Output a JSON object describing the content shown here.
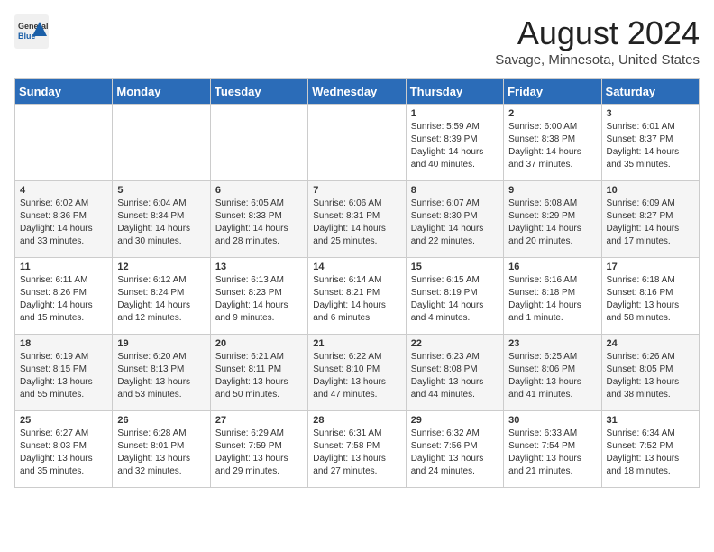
{
  "header": {
    "logo_general": "General",
    "logo_blue": "Blue",
    "month": "August 2024",
    "location": "Savage, Minnesota, United States"
  },
  "weekdays": [
    "Sunday",
    "Monday",
    "Tuesday",
    "Wednesday",
    "Thursday",
    "Friday",
    "Saturday"
  ],
  "weeks": [
    [
      {
        "day": "",
        "info": ""
      },
      {
        "day": "",
        "info": ""
      },
      {
        "day": "",
        "info": ""
      },
      {
        "day": "",
        "info": ""
      },
      {
        "day": "1",
        "sunrise": "Sunrise: 5:59 AM",
        "sunset": "Sunset: 8:39 PM",
        "daylight": "Daylight: 14 hours and 40 minutes."
      },
      {
        "day": "2",
        "sunrise": "Sunrise: 6:00 AM",
        "sunset": "Sunset: 8:38 PM",
        "daylight": "Daylight: 14 hours and 37 minutes."
      },
      {
        "day": "3",
        "sunrise": "Sunrise: 6:01 AM",
        "sunset": "Sunset: 8:37 PM",
        "daylight": "Daylight: 14 hours and 35 minutes."
      }
    ],
    [
      {
        "day": "4",
        "sunrise": "Sunrise: 6:02 AM",
        "sunset": "Sunset: 8:36 PM",
        "daylight": "Daylight: 14 hours and 33 minutes."
      },
      {
        "day": "5",
        "sunrise": "Sunrise: 6:04 AM",
        "sunset": "Sunset: 8:34 PM",
        "daylight": "Daylight: 14 hours and 30 minutes."
      },
      {
        "day": "6",
        "sunrise": "Sunrise: 6:05 AM",
        "sunset": "Sunset: 8:33 PM",
        "daylight": "Daylight: 14 hours and 28 minutes."
      },
      {
        "day": "7",
        "sunrise": "Sunrise: 6:06 AM",
        "sunset": "Sunset: 8:31 PM",
        "daylight": "Daylight: 14 hours and 25 minutes."
      },
      {
        "day": "8",
        "sunrise": "Sunrise: 6:07 AM",
        "sunset": "Sunset: 8:30 PM",
        "daylight": "Daylight: 14 hours and 22 minutes."
      },
      {
        "day": "9",
        "sunrise": "Sunrise: 6:08 AM",
        "sunset": "Sunset: 8:29 PM",
        "daylight": "Daylight: 14 hours and 20 minutes."
      },
      {
        "day": "10",
        "sunrise": "Sunrise: 6:09 AM",
        "sunset": "Sunset: 8:27 PM",
        "daylight": "Daylight: 14 hours and 17 minutes."
      }
    ],
    [
      {
        "day": "11",
        "sunrise": "Sunrise: 6:11 AM",
        "sunset": "Sunset: 8:26 PM",
        "daylight": "Daylight: 14 hours and 15 minutes."
      },
      {
        "day": "12",
        "sunrise": "Sunrise: 6:12 AM",
        "sunset": "Sunset: 8:24 PM",
        "daylight": "Daylight: 14 hours and 12 minutes."
      },
      {
        "day": "13",
        "sunrise": "Sunrise: 6:13 AM",
        "sunset": "Sunset: 8:23 PM",
        "daylight": "Daylight: 14 hours and 9 minutes."
      },
      {
        "day": "14",
        "sunrise": "Sunrise: 6:14 AM",
        "sunset": "Sunset: 8:21 PM",
        "daylight": "Daylight: 14 hours and 6 minutes."
      },
      {
        "day": "15",
        "sunrise": "Sunrise: 6:15 AM",
        "sunset": "Sunset: 8:19 PM",
        "daylight": "Daylight: 14 hours and 4 minutes."
      },
      {
        "day": "16",
        "sunrise": "Sunrise: 6:16 AM",
        "sunset": "Sunset: 8:18 PM",
        "daylight": "Daylight: 14 hours and 1 minute."
      },
      {
        "day": "17",
        "sunrise": "Sunrise: 6:18 AM",
        "sunset": "Sunset: 8:16 PM",
        "daylight": "Daylight: 13 hours and 58 minutes."
      }
    ],
    [
      {
        "day": "18",
        "sunrise": "Sunrise: 6:19 AM",
        "sunset": "Sunset: 8:15 PM",
        "daylight": "Daylight: 13 hours and 55 minutes."
      },
      {
        "day": "19",
        "sunrise": "Sunrise: 6:20 AM",
        "sunset": "Sunset: 8:13 PM",
        "daylight": "Daylight: 13 hours and 53 minutes."
      },
      {
        "day": "20",
        "sunrise": "Sunrise: 6:21 AM",
        "sunset": "Sunset: 8:11 PM",
        "daylight": "Daylight: 13 hours and 50 minutes."
      },
      {
        "day": "21",
        "sunrise": "Sunrise: 6:22 AM",
        "sunset": "Sunset: 8:10 PM",
        "daylight": "Daylight: 13 hours and 47 minutes."
      },
      {
        "day": "22",
        "sunrise": "Sunrise: 6:23 AM",
        "sunset": "Sunset: 8:08 PM",
        "daylight": "Daylight: 13 hours and 44 minutes."
      },
      {
        "day": "23",
        "sunrise": "Sunrise: 6:25 AM",
        "sunset": "Sunset: 8:06 PM",
        "daylight": "Daylight: 13 hours and 41 minutes."
      },
      {
        "day": "24",
        "sunrise": "Sunrise: 6:26 AM",
        "sunset": "Sunset: 8:05 PM",
        "daylight": "Daylight: 13 hours and 38 minutes."
      }
    ],
    [
      {
        "day": "25",
        "sunrise": "Sunrise: 6:27 AM",
        "sunset": "Sunset: 8:03 PM",
        "daylight": "Daylight: 13 hours and 35 minutes."
      },
      {
        "day": "26",
        "sunrise": "Sunrise: 6:28 AM",
        "sunset": "Sunset: 8:01 PM",
        "daylight": "Daylight: 13 hours and 32 minutes."
      },
      {
        "day": "27",
        "sunrise": "Sunrise: 6:29 AM",
        "sunset": "Sunset: 7:59 PM",
        "daylight": "Daylight: 13 hours and 29 minutes."
      },
      {
        "day": "28",
        "sunrise": "Sunrise: 6:31 AM",
        "sunset": "Sunset: 7:58 PM",
        "daylight": "Daylight: 13 hours and 27 minutes."
      },
      {
        "day": "29",
        "sunrise": "Sunrise: 6:32 AM",
        "sunset": "Sunset: 7:56 PM",
        "daylight": "Daylight: 13 hours and 24 minutes."
      },
      {
        "day": "30",
        "sunrise": "Sunrise: 6:33 AM",
        "sunset": "Sunset: 7:54 PM",
        "daylight": "Daylight: 13 hours and 21 minutes."
      },
      {
        "day": "31",
        "sunrise": "Sunrise: 6:34 AM",
        "sunset": "Sunset: 7:52 PM",
        "daylight": "Daylight: 13 hours and 18 minutes."
      }
    ]
  ]
}
